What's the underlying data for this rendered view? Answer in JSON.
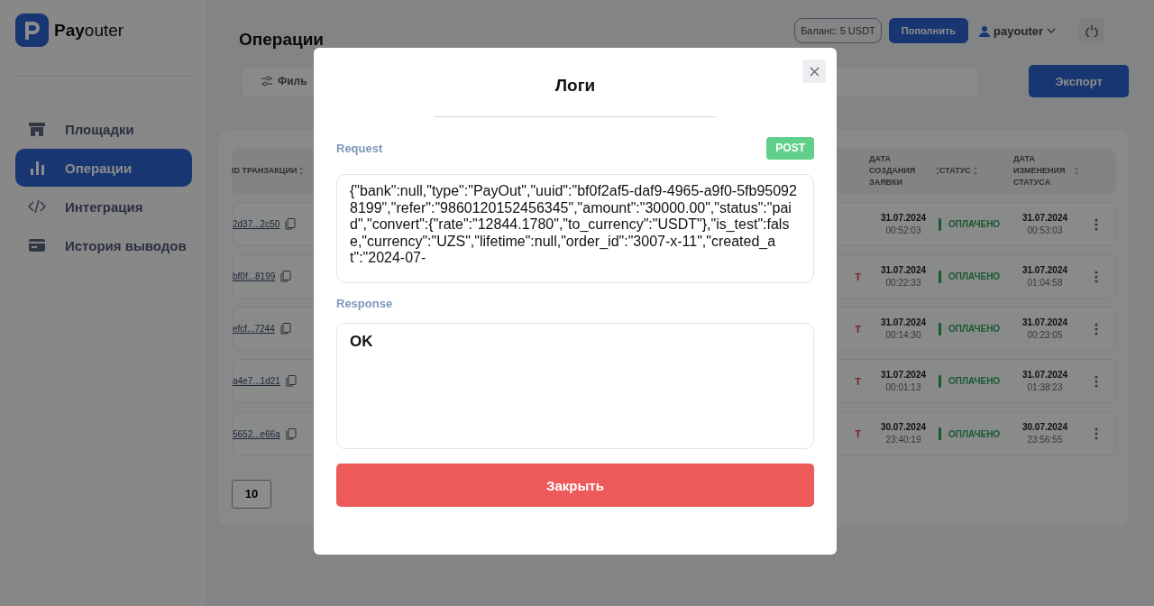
{
  "app": {
    "logo_text": "**Pay**outer"
  },
  "sidebar": {
    "items": [
      {
        "label": "Площадки",
        "selected": false
      },
      {
        "label": "Операции",
        "selected": true
      },
      {
        "label": "Интеграция",
        "selected": false
      },
      {
        "label": "История выводов",
        "selected": false
      }
    ]
  },
  "header": {
    "title": "Операции",
    "balance": "Баланс: 5 USDT",
    "top_up_button": "Пополнить",
    "user": "payouter"
  },
  "toolbar": {
    "filter_button": "Филь",
    "export_button": "Экспорт"
  },
  "table": {
    "columns": [
      {
        "label": "ID ТРАНЗАКЦИИ"
      },
      {
        "label": "ДАТА СОЗДАНИЯ ЗАЯВКИ"
      },
      {
        "label": "СТАТУС"
      },
      {
        "label": "ДАТА ИЗМЕНЕНИЯ СТАТУСА"
      }
    ],
    "rows": [
      {
        "id": "2d37...2c50",
        "created_date": "31.07.2024",
        "created_time": "00:52:03",
        "status": "ОПЛАЧЕНО",
        "changed_date": "31.07.2024",
        "changed_time": "00:53:03"
      },
      {
        "id": "bf0f...8199",
        "column_partial": "T",
        "created_date": "31.07.2024",
        "created_time": "00:22:33",
        "status": "ОПЛАЧЕНО",
        "changed_date": "31.07.2024",
        "changed_time": "01:04:58"
      },
      {
        "id": "efcf...7244",
        "column_partial": "T",
        "created_date": "31.07.2024",
        "created_time": "00:14:30",
        "status": "ОПЛАЧЕНО",
        "changed_date": "31.07.2024",
        "changed_time": "00:23:05"
      },
      {
        "id": "a4e7...1d21",
        "column_partial": "T",
        "created_date": "31.07.2024",
        "created_time": "00:01:13",
        "status": "ОПЛАЧЕНО",
        "changed_date": "31.07.2024",
        "changed_time": "01:38:23"
      },
      {
        "id": "5652...e66a",
        "column_partial": "T",
        "created_date": "30.07.2024",
        "created_time": "23:40:19",
        "status": "ОПЛАЧЕНО",
        "changed_date": "30.07.2024",
        "changed_time": "23:56:55"
      }
    ]
  },
  "pagination": {
    "page_size": "10"
  },
  "modal": {
    "title": "Логи",
    "request_label": "Request",
    "method": "POST",
    "request_body": "{\"bank\":null,\"type\":\"PayOut\",\"uuid\":\"bf0f2af5-daf9-4965-a9f0-5fb950928199\",\"refer\":\"9860120152456345\",\"amount\":\"30000.00\",\"status\":\"paid\",\"convert\":{\"rate\":\"12844.1780\",\"to_currency\":\"USDT\"},\"is_test\":false,\"currency\":\"UZS\",\"lifetime\":null,\"order_id\":\"3007-x-11\",\"created_at\":\"2024-07-",
    "response_label": "Response",
    "response_body": "OK",
    "close_button": "Закрыть"
  }
}
